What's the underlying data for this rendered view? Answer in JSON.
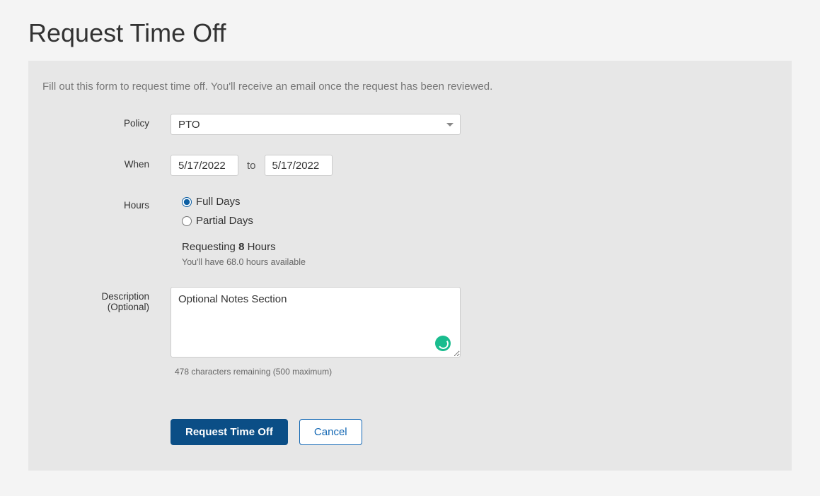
{
  "page": {
    "title": "Request Time Off",
    "instructions": "Fill out this form to request time off. You'll receive an email once the request has been reviewed."
  },
  "form": {
    "policy": {
      "label": "Policy",
      "selected": "PTO"
    },
    "when": {
      "label": "When",
      "from": "5/17/2022",
      "to_label": "to",
      "to": "5/17/2022"
    },
    "hours": {
      "label": "Hours",
      "option_full": "Full Days",
      "option_partial": "Partial Days",
      "requesting_prefix": "Requesting ",
      "requesting_value": "8",
      "requesting_suffix": " Hours",
      "available_text": "You'll have 68.0 hours available"
    },
    "description": {
      "label_main": "Description",
      "label_sub": "(Optional)",
      "value": "Optional Notes Section",
      "char_remaining": "478 characters remaining (500 maximum)"
    }
  },
  "actions": {
    "submit": "Request Time Off",
    "cancel": "Cancel"
  }
}
